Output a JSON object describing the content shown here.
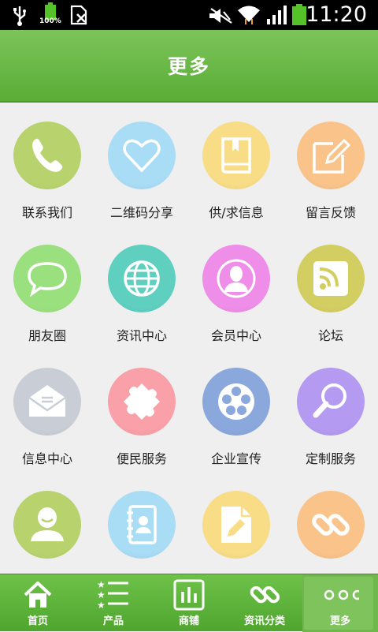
{
  "status_bar": {
    "time": "11:20",
    "battery_percent": "100%",
    "icons": [
      "usb-icon",
      "battery-icon",
      "sim-card-icon",
      "mute-icon",
      "wifi-icon",
      "signal-icon",
      "battery-icon"
    ]
  },
  "header": {
    "title": "更多"
  },
  "grid": {
    "items": [
      {
        "label": "联系我们",
        "icon": "phone-icon",
        "color": "#b8d36e"
      },
      {
        "label": "二维码分享",
        "icon": "heart-icon",
        "color": "#a9dcf5"
      },
      {
        "label": "供/求信息",
        "icon": "book-icon",
        "color": "#f8dc86"
      },
      {
        "label": "留言反馈",
        "icon": "edit-icon",
        "color": "#f9c38a"
      },
      {
        "label": "朋友圈",
        "icon": "chat-bubble-icon",
        "color": "#9be07e"
      },
      {
        "label": "资讯中心",
        "icon": "globe-icon",
        "color": "#5fcfc0"
      },
      {
        "label": "会员中心",
        "icon": "user-profile-icon",
        "color": "#ee8ee8"
      },
      {
        "label": "论坛",
        "icon": "rss-icon",
        "color": "#d3ce62"
      },
      {
        "label": "信息中心",
        "icon": "mail-icon",
        "color": "#c9ced6"
      },
      {
        "label": "便民服务",
        "icon": "puzzle-icon",
        "color": "#f9a0a8"
      },
      {
        "label": "企业宣传",
        "icon": "film-reel-icon",
        "color": "#8aa8dc"
      },
      {
        "label": "定制服务",
        "icon": "magnifier-icon",
        "color": "#b49af0"
      },
      {
        "label": "",
        "icon": "person-icon",
        "color": "#b8d36e"
      },
      {
        "label": "",
        "icon": "contacts-book-icon",
        "color": "#a9dcf5"
      },
      {
        "label": "",
        "icon": "document-pen-icon",
        "color": "#f8dc86"
      },
      {
        "label": "",
        "icon": "link-icon",
        "color": "#f9c38a"
      }
    ]
  },
  "tabbar": {
    "tabs": [
      {
        "label": "首页",
        "icon": "home-icon"
      },
      {
        "label": "产品",
        "icon": "list-stars-icon"
      },
      {
        "label": "商铺",
        "icon": "bar-chart-icon"
      },
      {
        "label": "资讯分类",
        "icon": "link-icon"
      },
      {
        "label": "更多",
        "icon": "more-dots-icon"
      }
    ],
    "active_index": 4
  }
}
